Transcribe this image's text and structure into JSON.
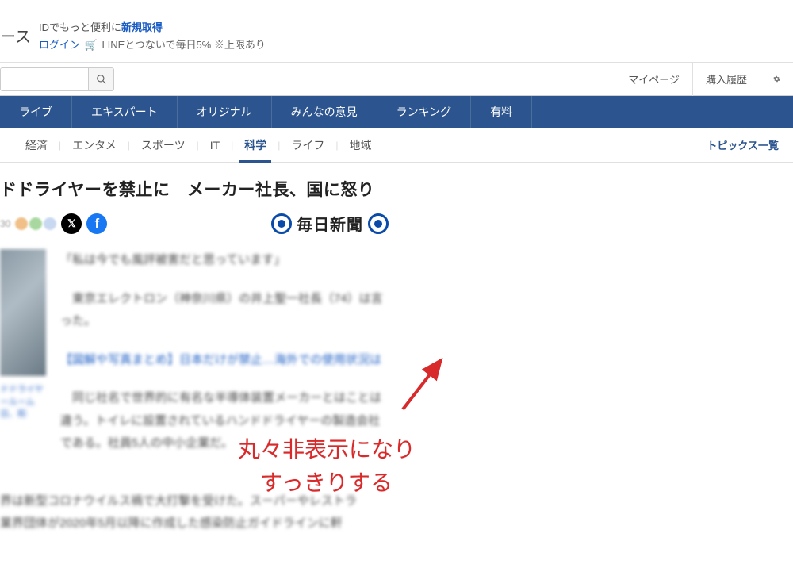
{
  "header": {
    "logo_suffix": "ース",
    "login_line1_prefix": "IDでもっと便利に",
    "login_line1_link": "新規取得",
    "login_link": "ログイン",
    "promo_text": "LINEとつないで毎日5% ※上限あり"
  },
  "userbar": {
    "mypage": "マイページ",
    "history": "購入履歴"
  },
  "nav_blue": [
    "ライブ",
    "エキスパート",
    "オリジナル",
    "みんなの意見",
    "ランキング",
    "有料"
  ],
  "categories": [
    "経済",
    "エンタメ",
    "スポーツ",
    "IT",
    "科学",
    "ライフ",
    "地域"
  ],
  "active_category": "科学",
  "topics_link": "トピックス一覧",
  "article": {
    "title": "ドドライヤーを禁止に　メーカー社長、国に怒り",
    "time_fragment": "30",
    "source_name": "毎日新聞",
    "quote": "「私は今でも風評被害だと思っています」",
    "para1": "　東京エレクトロン（神奈川県）の井上聖一社長（74）は言った。",
    "link_para": "【図解や写真まとめ】日本だけが禁止…海外での使用状況は",
    "para2": "　同じ社名で世界的に有名な半導体装置メーカーとはことは違う。トイレに設置されているハンドドライヤーの製造会社である。社員5人の中小企業だ。",
    "para3": "界は新型コロナウイルス禍で大打撃を受けた。スーパーやレストラ業界団体が2020年5月以降に作成した感染防止ガイドラインに軒",
    "caption": "ドドライヤールーム日、和"
  },
  "annotation": {
    "line1": "丸々非表示になり",
    "line2": "すっきりする"
  }
}
